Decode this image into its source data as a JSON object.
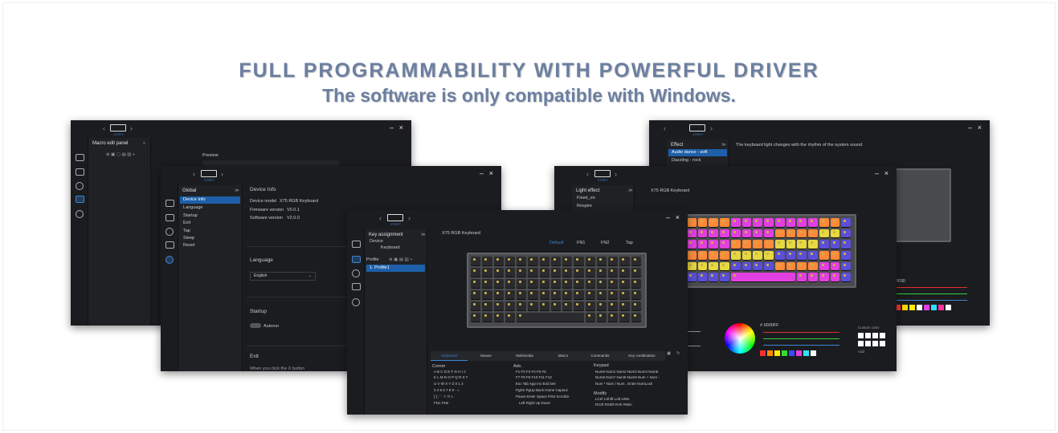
{
  "headline": {
    "title": "FULL PROGRAMMABILITY WITH POWERFUL DRIVER",
    "subtitle": "The software is only compatible with Windows."
  },
  "common": {
    "logo_sub": "XTRFY",
    "minimize": "–",
    "close": "×",
    "nav_prev": "‹",
    "nav_next": "›",
    "expand": "≫",
    "device_name": "X75 RGB Keyboard"
  },
  "macro_window": {
    "panel_title": "Macro edit panel",
    "preview_label": "Preview"
  },
  "global_window": {
    "panel_title": "Global",
    "menu": [
      "Device Info",
      "Language",
      "Startup",
      "Exit",
      "Tap",
      "Sleep",
      "Reset"
    ],
    "selected": "Device Info",
    "device_info_title": "Device Info",
    "rows": [
      {
        "label": "Device model",
        "value": "X75 RGB Keyboard"
      },
      {
        "label": "Firmware version",
        "value": "V0.0.1"
      },
      {
        "label": "Software version",
        "value": "V2.0.0"
      }
    ],
    "language_title": "Language",
    "language_value": "English",
    "startup_title": "Startup",
    "autorun_label": "Autorun",
    "exit_title": "Exit",
    "exit_desc": "When you click the X button"
  },
  "key_window": {
    "panel_title": "Key assignment",
    "device_label": "Device",
    "device_value": "Keyboard",
    "profile_label": "Profile",
    "profile_item": "1. Profile1",
    "layers": [
      "Default",
      "FN1",
      "FN2",
      "Tap"
    ],
    "bottom_tabs": [
      "Keyboard",
      "Mouse",
      "Multimedia",
      "Macro",
      "Commands",
      "Key combination"
    ],
    "comm_title": "Comm",
    "comm_rows": [
      "A  B  C  D  E  F  G  H  I  J",
      "K  L  M  N  O  P  Q  R  S  T",
      "U  V  W  X  Y  Z  0  1  2",
      "3  4  5  6  7  8  9  -  =",
      "[  ]  ;  '  `  <  ?/  >.",
      "FN1  FN2"
    ],
    "adv_title": "Adv.",
    "adv_rows": [
      "F1   F2   F3   F4   F5   F6",
      "F7   F8   F9   F10  F11  F12",
      "Esc  Tab  App  Ins  End  Del",
      "PgDn PgUp Back Home CapsLk",
      "Pause Enter Space Print ScrollLk",
      "Left  Right  Up  Down"
    ],
    "keypad_title": "Keypad",
    "keypad_rows": [
      "Num0  Num1  Num2  Num3  Num4  Num5",
      "Num6  Num7  Num8  Num9  Num +  Num -",
      "Num *  Num /  Num .  Enter  NumLock"
    ],
    "modify_title": "Modify",
    "modify_rows": [
      "LCtrl  LShift  LAlt  LWin",
      "RCtrl  RShift  RAlt  RWin"
    ]
  },
  "light_window": {
    "panel_title": "Light effect",
    "items": [
      "Fixed_on",
      "Respire"
    ],
    "hex_value": "# 0000FF",
    "custom_color_label": "Custom color",
    "add_label": "Add"
  },
  "effect_window": {
    "panel_title": "Effect",
    "items": [
      "Audio dance - soft",
      "Dazzling - rock"
    ],
    "desc": "The keyboard light changes with the rhythm of the system sound",
    "hex_partial": "FF00"
  },
  "colors": {
    "accent": "#3d86d6",
    "window_bg": "#1b1c1f",
    "headline": "#6b7fa1",
    "key_yellow": "#c9b14c",
    "rgb_pink": "#e23fe0",
    "rgb_orange": "#ff8a3a",
    "rgb_blue": "#5b4fd8"
  }
}
